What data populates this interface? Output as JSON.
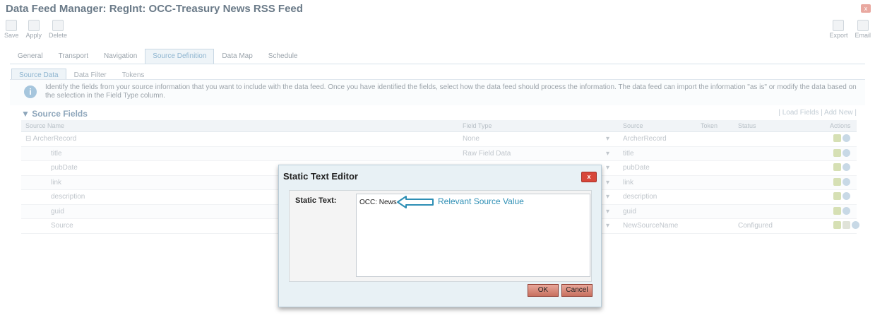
{
  "window": {
    "title": "Data Feed Manager: RegInt: OCC-Treasury News RSS Feed",
    "close_glyph": "x"
  },
  "toolbar": {
    "left": [
      {
        "label": "Save",
        "icon": "save-icon"
      },
      {
        "label": "Apply",
        "icon": "apply-icon"
      },
      {
        "label": "Delete",
        "icon": "delete-icon"
      }
    ],
    "right": [
      {
        "label": "Export",
        "icon": "export-icon"
      },
      {
        "label": "Email",
        "icon": "email-icon"
      }
    ]
  },
  "tabs": [
    "General",
    "Transport",
    "Navigation",
    "Source Definition",
    "Data Map",
    "Schedule"
  ],
  "active_tab": "Source Definition",
  "subtabs": [
    "Source Data",
    "Data Filter",
    "Tokens"
  ],
  "active_subtab": "Source Data",
  "info": {
    "text": "Identify the fields from your source information that you want to include with the data feed. Once you have identified the fields, select how the data feed should process the information. The data feed can import the information \"as is\" or modify the data based on the selection in the Field Type column."
  },
  "source_fields": {
    "heading": "▼ Source Fields",
    "links": {
      "load": "Load Fields",
      "add": "Add New"
    },
    "columns": [
      "Source Name",
      "Field Type",
      "Source",
      "Token",
      "Status",
      "Actions"
    ],
    "rows": [
      {
        "name": "⊟  ArcherRecord",
        "type": "None",
        "source": "ArcherRecord",
        "status": ""
      },
      {
        "name": "title",
        "type": "Raw Field Data",
        "source": "title",
        "status": ""
      },
      {
        "name": "pubDate",
        "type": "",
        "source": "pubDate",
        "status": ""
      },
      {
        "name": "link",
        "type": "",
        "source": "link",
        "status": ""
      },
      {
        "name": "description",
        "type": "",
        "source": "description",
        "status": ""
      },
      {
        "name": "guid",
        "type": "",
        "source": "guid",
        "status": ""
      },
      {
        "name": "Source",
        "type": "",
        "source": "NewSourceName",
        "status": "Configured"
      }
    ]
  },
  "dialog": {
    "title": "Static Text Editor",
    "close_glyph": "x",
    "label": "Static Text:",
    "value": "OCC: News",
    "annotation": "Relevant Source Value",
    "ok": "OK",
    "cancel": "Cancel"
  }
}
